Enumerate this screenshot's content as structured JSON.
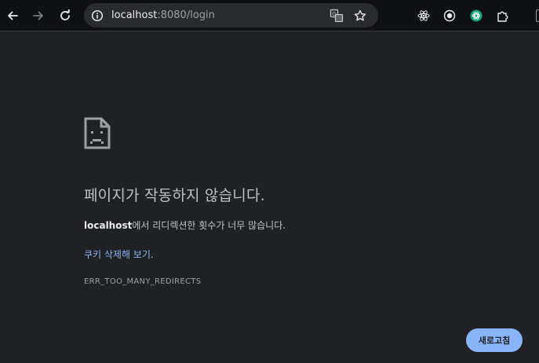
{
  "browser": {
    "url_host": "localhost",
    "url_rest": ":8080/login",
    "nav_icons": [
      "back-arrow-icon",
      "forward-arrow-icon",
      "reload-icon"
    ],
    "omnibox_icons": [
      "site-info-icon",
      "translate-icon",
      "bookmark-star-icon"
    ],
    "extension_icons": [
      "react-devtools-icon",
      "record-icon",
      "chatgpt-icon",
      "extensions-puzzle-icon"
    ]
  },
  "error": {
    "title": "페이지가 작동하지 않습니다.",
    "host": "localhost",
    "desc_suffix": "에서 리디렉션한 횟수가 너무 많습니다.",
    "link_text": "쿠키 삭제해 보기",
    "link_suffix": ".",
    "code": "ERR_TOO_MANY_REDIRECTS",
    "reload_label": "새로고침"
  },
  "colors": {
    "page_bg": "#202124",
    "toolbar_bg": "#0f1011",
    "accent": "#8ab4f8",
    "chatgpt_green": "#10a37f"
  }
}
